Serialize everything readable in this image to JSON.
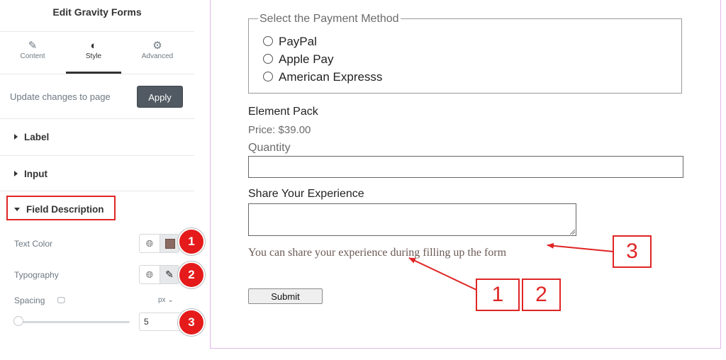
{
  "panel": {
    "title": "Edit Gravity Forms",
    "tabs": [
      {
        "label": "Content",
        "icon": "pencil-icon"
      },
      {
        "label": "Style",
        "icon": "half-circle-icon"
      },
      {
        "label": "Advanced",
        "icon": "gear-icon"
      }
    ],
    "active_tab": "Style",
    "update_text": "Update changes to page",
    "apply_label": "Apply",
    "sections": [
      {
        "label": "Label",
        "expanded": false
      },
      {
        "label": "Input",
        "expanded": false
      },
      {
        "label": "Field Description",
        "expanded": true
      }
    ],
    "controls": {
      "text_color_label": "Text Color",
      "text_color_value": "#8a6a63",
      "typography_label": "Typography",
      "spacing_label": "Spacing",
      "spacing_unit": "px",
      "spacing_value": "5"
    }
  },
  "badges": [
    "1",
    "2",
    "3"
  ],
  "preview": {
    "payment_legend": "Select the Payment Method",
    "payment_options": [
      "PayPal",
      "Apple Pay",
      "American Expresss"
    ],
    "product_name": "Element Pack",
    "product_price": "Price: $39.00",
    "quantity_label": "Quantity",
    "share_label": "Share Your Experience",
    "field_description": "You can share your experience during filling up the form",
    "submit_label": "Submit"
  },
  "callouts": [
    "1",
    "2",
    "3"
  ],
  "colors": {
    "annotation_red": "#e02525",
    "badge_red": "#e51b1b",
    "preview_border": "#e0b7e9"
  }
}
